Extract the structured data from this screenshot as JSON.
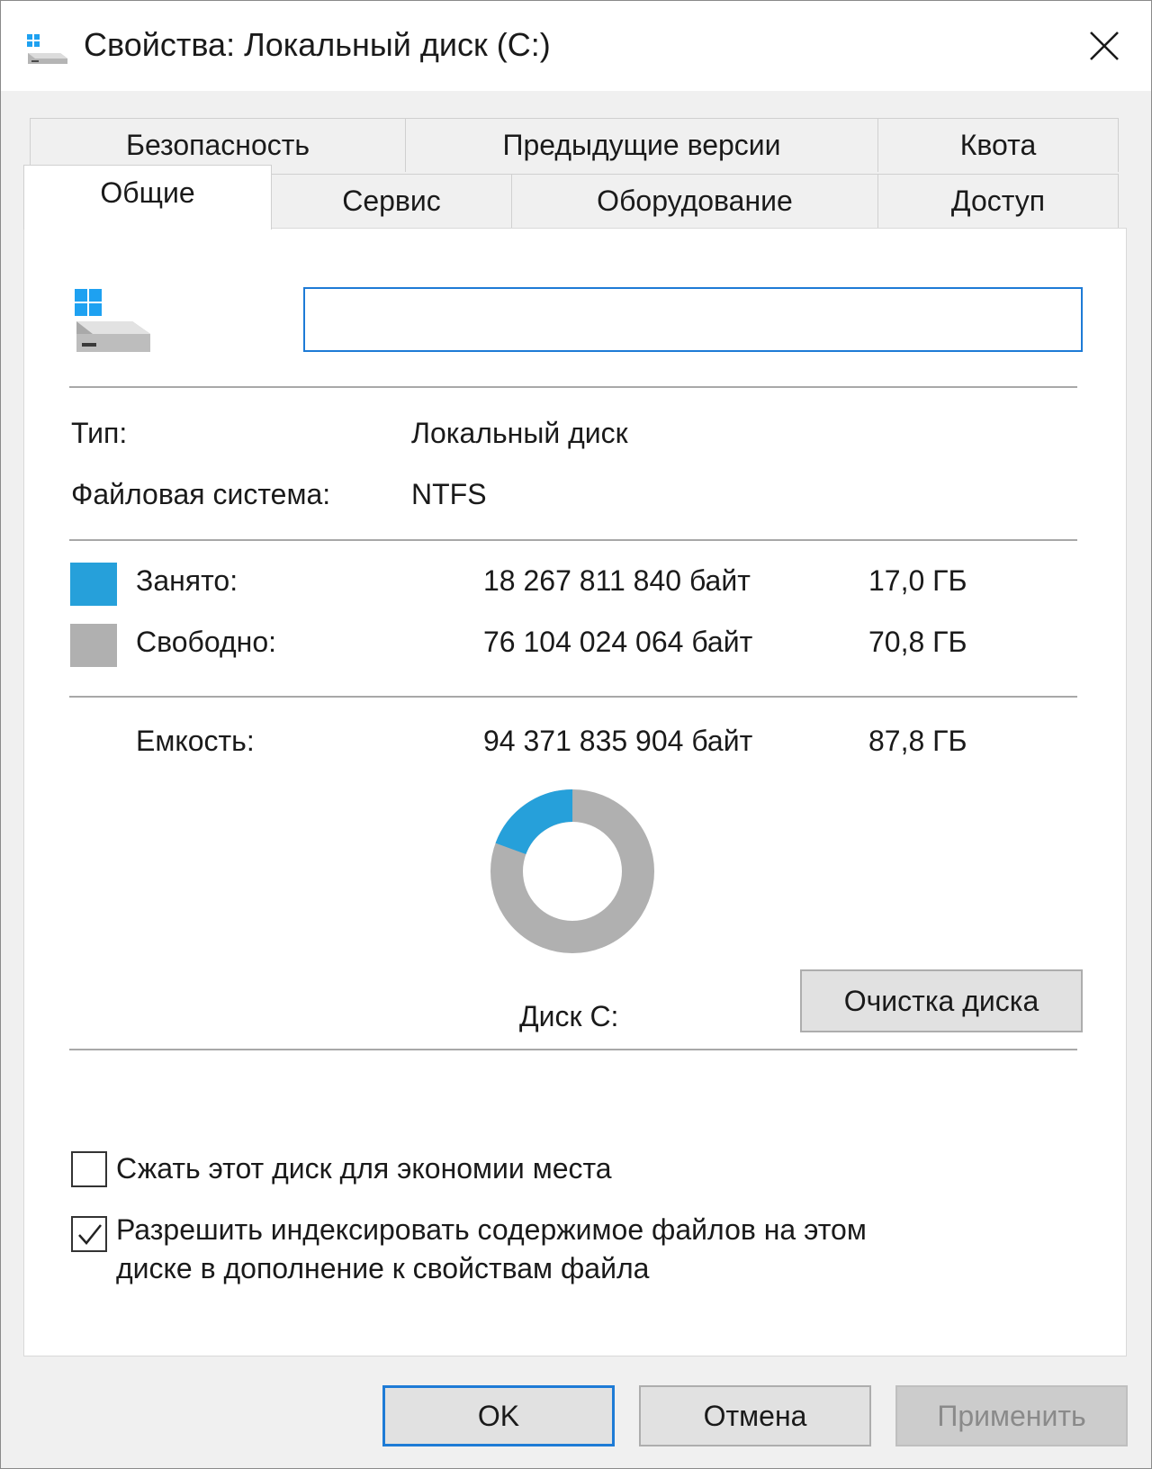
{
  "window": {
    "title": "Свойства: Локальный диск (C:)",
    "icon": "drive-icon"
  },
  "tabs": {
    "row1": [
      "Безопасность",
      "Предыдущие версии",
      "Квота"
    ],
    "row2": [
      "Общие",
      "Сервис",
      "Оборудование",
      "Доступ"
    ],
    "active": "Общие"
  },
  "general": {
    "volume_label": "",
    "type_label": "Тип:",
    "type_value": "Локальный диск",
    "fs_label": "Файловая система:",
    "fs_value": "NTFS",
    "used": {
      "label": "Занято:",
      "bytes": "18 267 811 840 байт",
      "size": "17,0 ГБ",
      "color": "#26a0da"
    },
    "free": {
      "label": "Свободно:",
      "bytes": "76 104 024 064 байт",
      "size": "70,8 ГБ",
      "color": "#b0b0b0"
    },
    "capacity": {
      "label": "Емкость:",
      "bytes": "94 371 835 904 байт",
      "size": "87,8 ГБ"
    },
    "used_fraction": 0.194,
    "disk_label": "Диск C:",
    "cleanup_button": "Очистка диска",
    "compress_checkbox": {
      "label": "Сжать этот диск для экономии места",
      "checked": false
    },
    "index_checkbox": {
      "label_line1": "Разрешить индексировать содержимое файлов на этом",
      "label_line2": "диске в дополнение к свойствам файла",
      "checked": true
    }
  },
  "buttons": {
    "ok": "OK",
    "cancel": "Отмена",
    "apply": "Применить"
  }
}
